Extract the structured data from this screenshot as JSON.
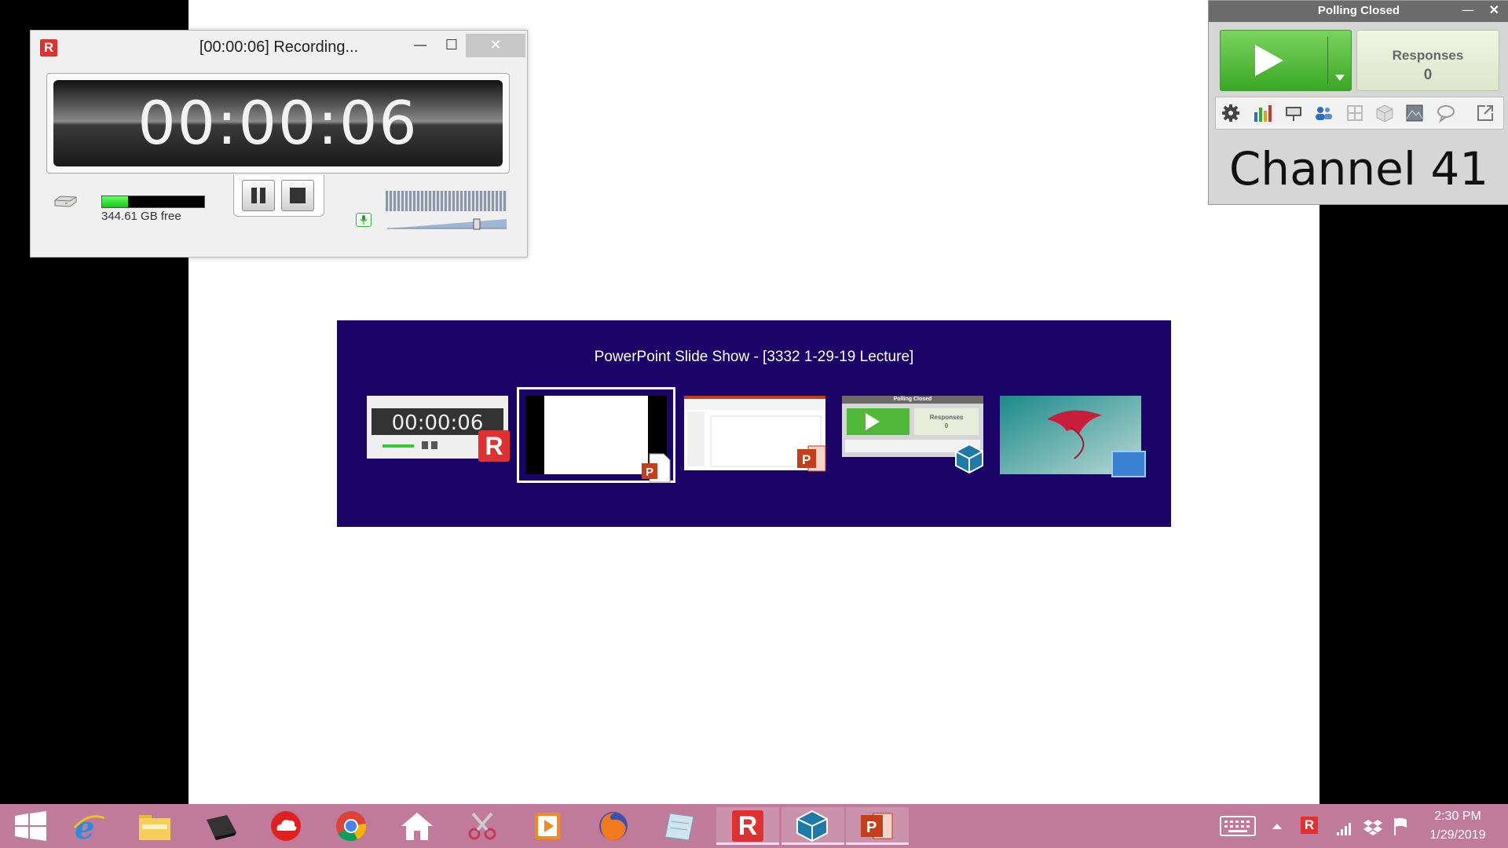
{
  "recorder": {
    "title": "[00:00:06] Recording...",
    "logo": "R",
    "timer": "00:00:06",
    "disk_free": "344.61 GB free",
    "disk_used_fraction": 0.25,
    "controls": [
      "pause",
      "stop"
    ]
  },
  "polling": {
    "title": "Polling Closed",
    "responses_label": "Responses",
    "responses_count": "0",
    "channel": "Channel 41",
    "tools": [
      "gear-icon",
      "bar-chart-icon",
      "presenter-icon",
      "participants-icon",
      "grid-icon",
      "cube-icon",
      "image-icon",
      "speech-bubble-icon",
      "export-icon"
    ]
  },
  "switcher": {
    "title": "PowerPoint Slide Show - [3332 1-29-19 Lecture]",
    "windows": [
      {
        "app": "Recorder",
        "timer": "00:00:06"
      },
      {
        "app": "PowerPoint Slide Show",
        "selected": true
      },
      {
        "app": "PowerPoint"
      },
      {
        "app": "Polling",
        "title": "Polling Closed",
        "label": "Responses",
        "count": "0"
      },
      {
        "app": "Desktop"
      }
    ]
  },
  "taskbar": {
    "apps": [
      "start",
      "internet-explorer",
      "file-explorer",
      "dark-app",
      "cloud-app",
      "chrome",
      "home",
      "snipping-tool",
      "media-player",
      "firefox",
      "notepad",
      "recorder",
      "polling",
      "powerpoint"
    ],
    "time": "2:30 PM",
    "date": "1/29/2019"
  }
}
